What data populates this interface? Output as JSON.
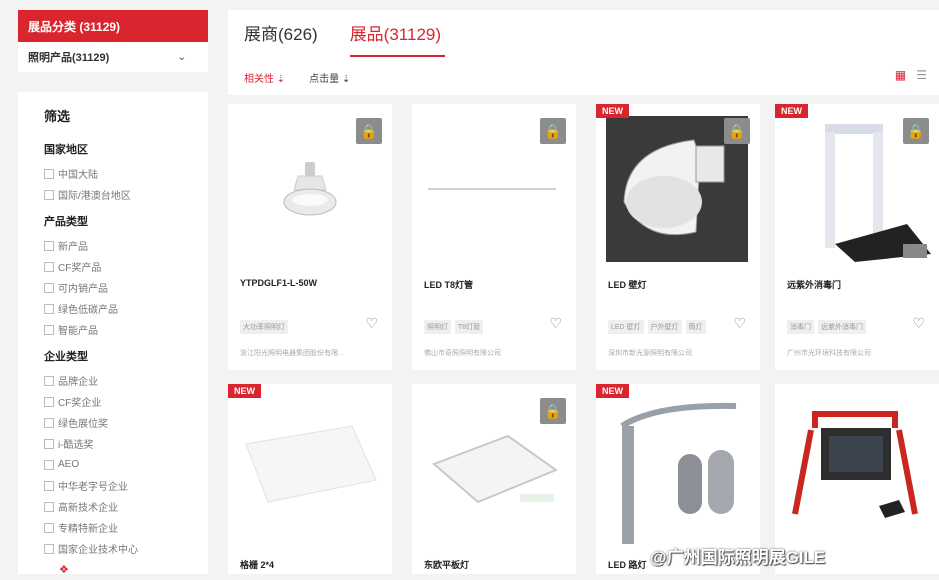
{
  "sidebar": {
    "category_header": "展品分类 (31129)",
    "category_sub": "照明产品(31129)",
    "filter_title": "筛选",
    "groups": [
      {
        "title": "国家地区",
        "options": [
          "中国大陆",
          "国际/港澳台地区"
        ]
      },
      {
        "title": "产品类型",
        "options": [
          "新产品",
          "CF奖产品",
          "可内销产品",
          "绿色低碳产品",
          "智能产品"
        ]
      },
      {
        "title": "企业类型",
        "options": [
          "品牌企业",
          "CF奖企业",
          "绿色展位奖",
          "i-酷选奖",
          "AEO",
          "中华老字号企业",
          "高新技术企业",
          "专精特新企业",
          "国家企业技术中心"
        ]
      }
    ]
  },
  "tabs": [
    {
      "label": "展商(626)"
    },
    {
      "label": "展品(31129)"
    }
  ],
  "sorts": [
    "相关性 ⇣",
    "点击量 ⇣"
  ],
  "icons": {
    "grid_view": "grid-view-icon",
    "list_view": "list-view-icon",
    "lock": "lock-icon",
    "heart": "heart-icon"
  },
  "products": [
    {
      "name": "YTPDGLF1-L-50W",
      "tags": [
        "大功率照明灯"
      ],
      "company": "浙江阳光照明电器集团股份有限...",
      "new": false,
      "locked": true
    },
    {
      "name": "LED T8灯管",
      "tags": [
        "照明灯",
        "T8灯管"
      ],
      "company": "佛山市奇照照明有限公司",
      "new": false,
      "locked": true
    },
    {
      "name": "LED 壁灯",
      "tags": [
        "LED 壁灯",
        "户外壁灯",
        "筒灯"
      ],
      "company": "深圳市新光源照明有限公司",
      "new": true,
      "locked": true
    },
    {
      "name": "远紫外消毒门",
      "tags": [
        "消毒门",
        "远紫外消毒门"
      ],
      "company": "广州市光环境科技有限公司",
      "new": true,
      "locked": true
    },
    {
      "name": "格栅 2*4",
      "tags": [],
      "company": "",
      "new": true,
      "locked": false
    },
    {
      "name": "东欧平板灯",
      "tags": [],
      "company": "",
      "new": false,
      "locked": true
    },
    {
      "name": "LED 路灯",
      "tags": [],
      "company": "",
      "new": true,
      "locked": false
    },
    {
      "name": "",
      "tags": [],
      "company": "",
      "new": false,
      "locked": false
    }
  ],
  "new_label": "NEW",
  "watermark": "@广州国际照明展GILE",
  "colors": {
    "accent": "#d9252e",
    "bg": "#f3f3f4"
  }
}
